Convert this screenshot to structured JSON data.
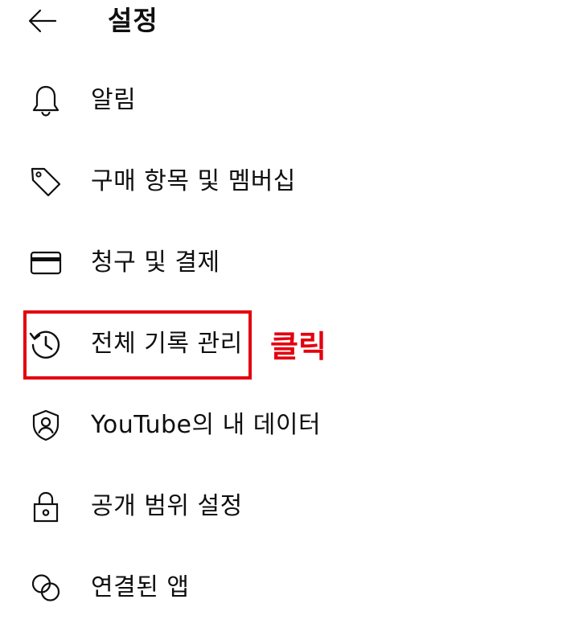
{
  "header": {
    "back_icon": "arrow-left-icon",
    "title": "설정"
  },
  "menu": {
    "items": [
      {
        "label": "알림",
        "icon": "bell-icon"
      },
      {
        "label": "구매 항목 및 멤버십",
        "icon": "tag-icon"
      },
      {
        "label": "청구 및 결제",
        "icon": "credit-card-icon"
      },
      {
        "label": "전체 기록 관리",
        "icon": "history-icon"
      },
      {
        "label": "YouTube의 내 데이터",
        "icon": "shield-person-icon"
      },
      {
        "label": "공개 범위 설정",
        "icon": "lock-icon"
      },
      {
        "label": "연결된 앱",
        "icon": "linked-circles-icon"
      }
    ]
  },
  "annotation": {
    "text": "클릭",
    "color": "#e3000f",
    "highlighted_item": "전체 기록 관리"
  },
  "colors": {
    "background": "#ffffff",
    "text": "#0f0f0f",
    "annotation": "#e3000f"
  }
}
